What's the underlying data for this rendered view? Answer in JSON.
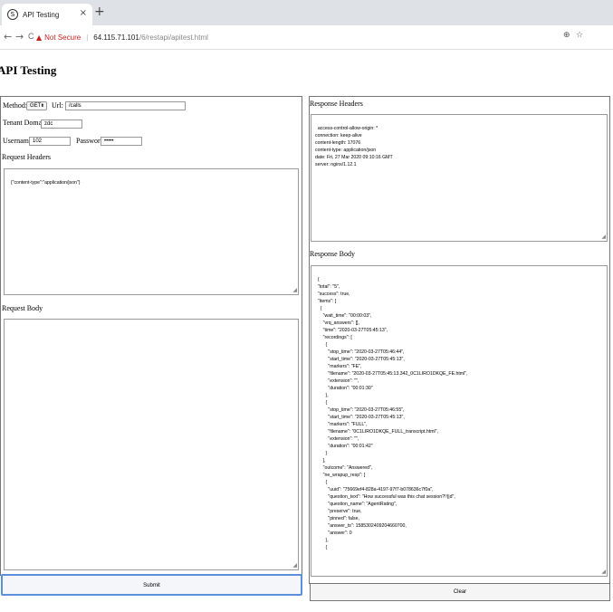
{
  "browser": {
    "tab_title": "API Testing",
    "tab_close": "×",
    "new_tab": "+",
    "nav_back": "←",
    "nav_forward": "→",
    "nav_reload": "C",
    "security_icon": "warning-triangle-icon",
    "security_label": "Not Secure",
    "separator": "|",
    "url_host": "64.115.71.101",
    "url_path": "/6/restapi/apitest.html",
    "zoom_icon": "🔍",
    "bookmark_icon": "☆"
  },
  "page": {
    "title": "API Testing"
  },
  "form": {
    "method_label": "Method:",
    "method_value": "GET",
    "url_label": "Url:",
    "url_value": "/calls",
    "tenant_label": "Tenant Domain:",
    "tenant_value": "zdc",
    "username_label": "Username:",
    "username_value": "102",
    "password_label": "Password:",
    "password_value": "•••••",
    "request_headers_label": "Request Headers",
    "request_headers_value": "{\"content-type\":\"application/json\"}",
    "request_body_label": "Request Body",
    "request_body_value": "",
    "submit_label": "Submit"
  },
  "response": {
    "headers_label": "Response Headers",
    "headers_value": "access-control-allow-origin: *\nconnection: keep-alive\ncontent-length: 17076\ncontent-type: application/json\ndate: Fri, 27 Mar 2020 09:10:16 GMT\nserver: nginx/1.12.1",
    "body_label": "Response Body",
    "body_value": "{\n  \"total\": \"5\",\n  \"success\": true,\n  \"items\": [\n    {\n      \"wait_time\": \"00:00:03\",\n      \"vrq_answers\": [],\n      \"time\": \"2020-03-27T05:45:13\",\n      \"recordings\": [\n        {\n          \"stop_time\": \"2020-03-27T05:46:44\",\n          \"start_time\": \"2020-03-27T05:45:13\",\n          \"markers\": \"FE\",\n          \"filename\": \"2020-03-27T05:45:13.342_0C1LIRO1DKQE_FE.html\",\n          \"extension\": \"\",\n          \"duration\": \"00:01:30\"\n        },\n        {\n          \"stop_time\": \"2020-03-27T05:46:55\",\n          \"start_time\": \"2020-03-27T05:45:13\",\n          \"markers\": \"FULL\",\n          \"filename\": \"0C1LIRO1DKQE_FULL_transcript.html\",\n          \"extension\": \"\",\n          \"duration\": \"00:01:42\"\n        }\n      ],\n      \"outcome\": \"Answered\",\n      \"ne_wrapup_resp\": [\n        {\n          \"uuid\": \"75669ef4-828a-4197-97f7-b078636c7f0a\",\n          \"question_text\": \"How successful was this chat session?!!||d\",\n          \"question_name\": \"AgentRating\",\n          \"preserve\": true,\n          \"pinned\": false,\n          \"answer_ts\": 1585302409204660700,\n          \"answer\": 0\n        },\n        {",
    "clear_label": "Clear"
  }
}
